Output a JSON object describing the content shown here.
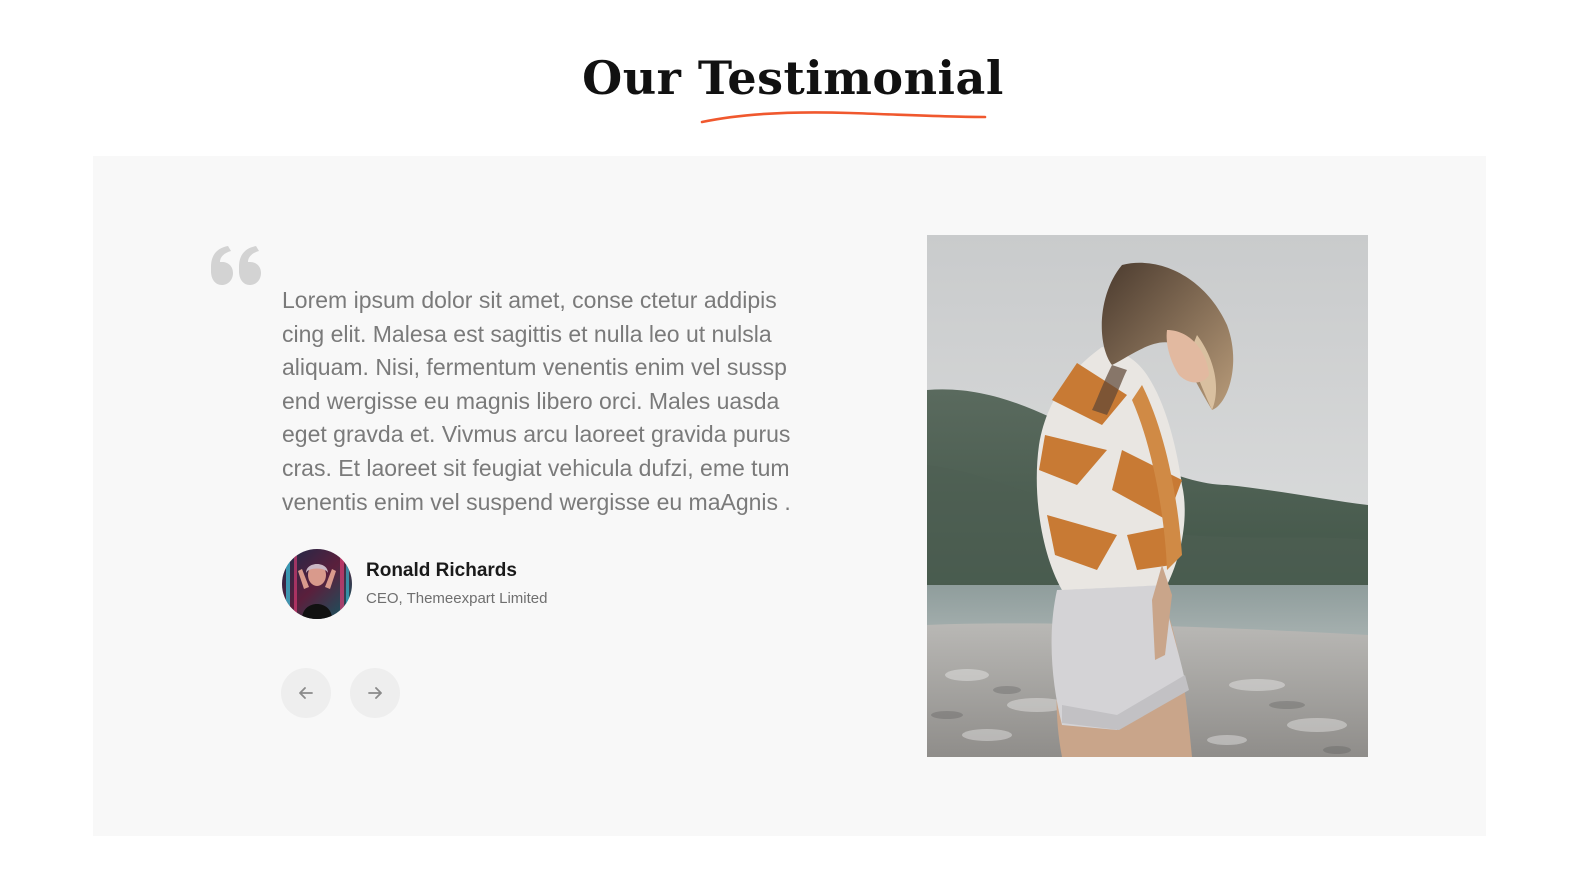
{
  "section": {
    "title": "Our Testimonial",
    "accent_color": "#f0582e"
  },
  "testimonial": {
    "quote_icon": "quote-icon",
    "text": "Lorem ipsum dolor sit amet, conse ctetur addipis cing elit. Malesa est sagittis et nulla leo ut nulsla aliquam. Nisi, fermentum venentis enim vel sussp end wergisse eu magnis libero orci. Males uasda eget gravda et. Vivmus arcu laoreet gravida purus cras. Et laoreet sit feugiat vehicula dufzi, eme tum venentis enim vel suspend wergisse eu maAgnis .",
    "author": {
      "name": "Ronald Richards",
      "role": "CEO, Themeexpart Limited",
      "avatar": "avatar-photo"
    },
    "photo": "woman-portrait-photo"
  },
  "navigation": {
    "prev_icon": "arrow-left-icon",
    "next_icon": "arrow-right-icon"
  },
  "colors": {
    "panel_bg": "#f8f8f8",
    "text_muted": "#7a7a7a",
    "button_bg": "#eeeeee"
  }
}
